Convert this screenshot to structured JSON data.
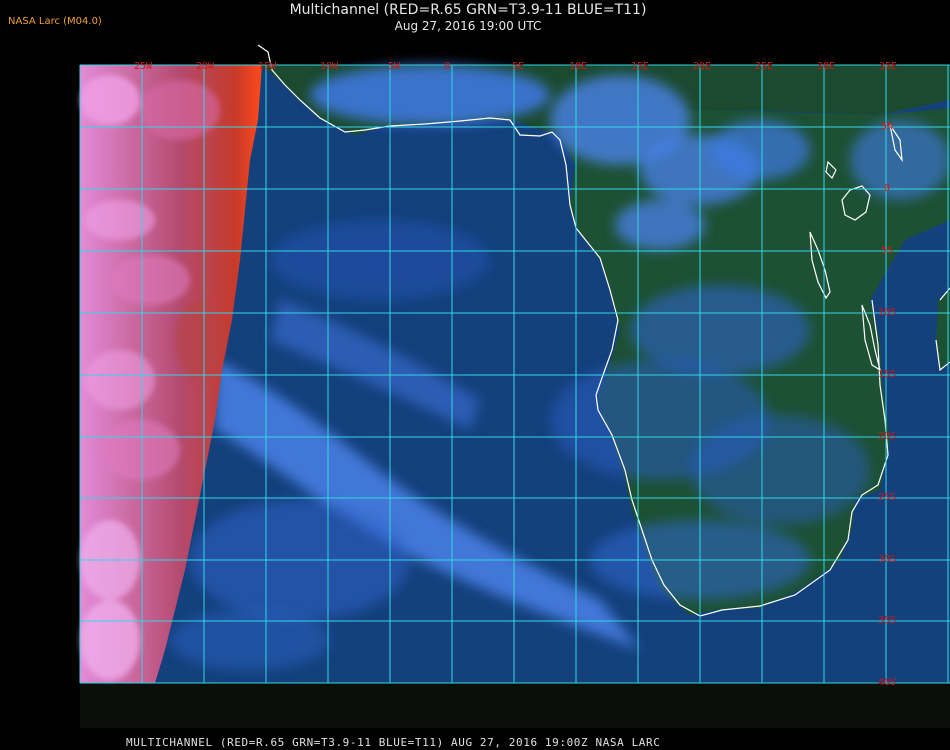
{
  "header": {
    "brand": "NASA Larc (M04.0)",
    "title": "Multichannel (RED=R.65 GRN=T3.9-11 BLUE=T11)",
    "subtitle": "Aug 27, 2016 19:00 UTC"
  },
  "footer": {
    "caption": "MULTICHANNEL (RED=R.65 GRN=T3.9-11 BLUE=T11) AUG 27, 2016 19:00Z  NASA LARC"
  },
  "map": {
    "longitude_labels": [
      "25W",
      "20W",
      "15W",
      "10W",
      "5W",
      "0",
      "5E",
      "10E",
      "15E",
      "20E",
      "25E",
      "30E",
      "35E"
    ],
    "latitude_labels": [
      "5N",
      "0",
      "5S",
      "10S",
      "15S",
      "20S",
      "25S",
      "30S",
      "35S",
      "40S"
    ],
    "colors": {
      "grid": "#33d6e6",
      "labels": "#d01818",
      "coastline": "#ffffff",
      "ocean": "#123d78",
      "land": "#1b4a30",
      "cloud_blue": "#3f7ae6",
      "edge_magenta": "#e88ad6",
      "edge_red": "#ff4a1a"
    }
  }
}
